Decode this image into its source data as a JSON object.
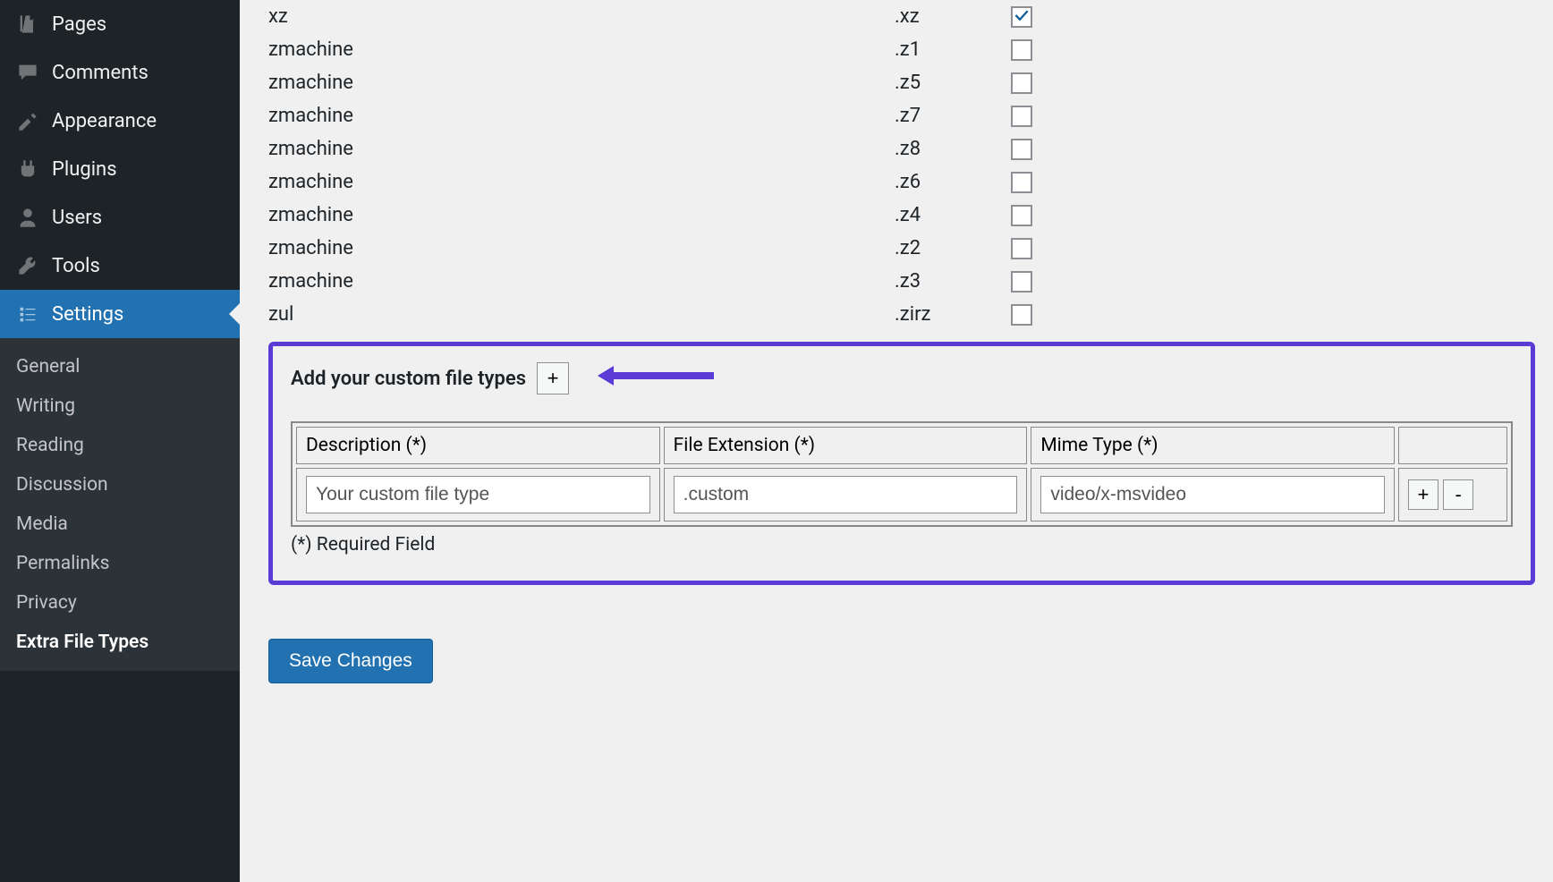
{
  "sidebar": {
    "menu": [
      {
        "label": "Pages",
        "icon": "pages"
      },
      {
        "label": "Comments",
        "icon": "comment"
      },
      {
        "label": "Appearance",
        "icon": "appearance"
      },
      {
        "label": "Plugins",
        "icon": "plugins"
      },
      {
        "label": "Users",
        "icon": "users"
      },
      {
        "label": "Tools",
        "icon": "tools"
      },
      {
        "label": "Settings",
        "icon": "settings"
      }
    ],
    "submenu": [
      {
        "label": "General"
      },
      {
        "label": "Writing"
      },
      {
        "label": "Reading"
      },
      {
        "label": "Discussion"
      },
      {
        "label": "Media"
      },
      {
        "label": "Permalinks"
      },
      {
        "label": "Privacy"
      },
      {
        "label": "Extra File Types"
      }
    ]
  },
  "filetypes": [
    {
      "name": "xz",
      "ext": ".xz",
      "checked": true
    },
    {
      "name": "zmachine",
      "ext": ".z1",
      "checked": false
    },
    {
      "name": "zmachine",
      "ext": ".z5",
      "checked": false
    },
    {
      "name": "zmachine",
      "ext": ".z7",
      "checked": false
    },
    {
      "name": "zmachine",
      "ext": ".z8",
      "checked": false
    },
    {
      "name": "zmachine",
      "ext": ".z6",
      "checked": false
    },
    {
      "name": "zmachine",
      "ext": ".z4",
      "checked": false
    },
    {
      "name": "zmachine",
      "ext": ".z2",
      "checked": false
    },
    {
      "name": "zmachine",
      "ext": ".z3",
      "checked": false
    },
    {
      "name": "zul",
      "ext": ".zirz",
      "checked": false
    }
  ],
  "custom": {
    "heading": "Add your custom file types",
    "add_label": "+",
    "headers": {
      "desc": "Description (*)",
      "ext": "File Extension (*)",
      "mime": "Mime Type (*)"
    },
    "row": {
      "desc": "Your custom file type",
      "ext": ".custom",
      "mime": "video/x-msvideo"
    },
    "plus": "+",
    "minus": "-",
    "note": "(*) Required Field"
  },
  "save_label": "Save Changes"
}
